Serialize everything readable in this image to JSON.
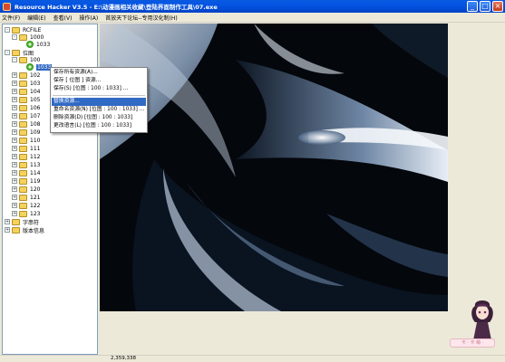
{
  "window": {
    "title": "Resource Hacker V3.5  -  E:\\动漫画相关收藏\\登陆界面制作工具\\07.exe",
    "minimize": "_",
    "maximize": "□",
    "close": "×"
  },
  "menu": [
    "文件(F)",
    "编辑(E)",
    "查看(V)",
    "操作(A)",
    "首放天下论坛--专用汉化制(H)"
  ],
  "tree": [
    {
      "label": "RCFILE",
      "icon": "folder-icon",
      "exp": "-"
    },
    {
      "label": "1000",
      "icon": "folder-icon",
      "exp": "-"
    },
    {
      "label": "1033",
      "icon": "gear-icon",
      "exp": ""
    },
    {
      "label": "位图",
      "icon": "folder-icon",
      "exp": "-"
    },
    {
      "label": "100",
      "icon": "folder-icon",
      "exp": "-"
    },
    {
      "label": "1033",
      "icon": "gear-icon",
      "exp": "",
      "selected": true
    },
    {
      "label": "102",
      "icon": "folder-icon",
      "exp": "+"
    },
    {
      "label": "103",
      "icon": "folder-icon",
      "exp": "+"
    },
    {
      "label": "104",
      "icon": "folder-icon",
      "exp": "+"
    },
    {
      "label": "105",
      "icon": "folder-icon",
      "exp": "+"
    },
    {
      "label": "106",
      "icon": "folder-icon",
      "exp": "+"
    },
    {
      "label": "107",
      "icon": "folder-icon",
      "exp": "+"
    },
    {
      "label": "108",
      "icon": "folder-icon",
      "exp": "+"
    },
    {
      "label": "109",
      "icon": "folder-icon",
      "exp": "+"
    },
    {
      "label": "110",
      "icon": "folder-icon",
      "exp": "+"
    },
    {
      "label": "111",
      "icon": "folder-icon",
      "exp": "+"
    },
    {
      "label": "112",
      "icon": "folder-icon",
      "exp": "+"
    },
    {
      "label": "113",
      "icon": "folder-icon",
      "exp": "+"
    },
    {
      "label": "114",
      "icon": "folder-icon",
      "exp": "+"
    },
    {
      "label": "119",
      "icon": "folder-icon",
      "exp": "+"
    },
    {
      "label": "120",
      "icon": "folder-icon",
      "exp": "+"
    },
    {
      "label": "121",
      "icon": "folder-icon",
      "exp": "+"
    },
    {
      "label": "122",
      "icon": "folder-icon",
      "exp": "+"
    },
    {
      "label": "123",
      "icon": "folder-icon",
      "exp": "+"
    },
    {
      "label": "字串符",
      "icon": "folder-icon",
      "exp": "+"
    },
    {
      "label": "版本信息",
      "icon": "folder-icon",
      "exp": "+"
    }
  ],
  "context_menu": {
    "items": [
      {
        "label": "保存所有资源(A)...",
        "highlight": false
      },
      {
        "label": "保存 [ 位图 ] 资源...",
        "highlight": false
      },
      {
        "label": "保存(S) [位图 : 100 : 1033] ...",
        "highlight": false
      },
      {
        "label": "替换资源...",
        "highlight": true
      },
      {
        "label": "重命名资源(N) [位图 : 100 : 1033] ...",
        "highlight": false
      },
      {
        "label": "删除资源(D) [位图 : 100 : 1033]",
        "highlight": false
      },
      {
        "label": "更改语言(L) [位图 : 100 : 1033]",
        "highlight": false
      }
    ]
  },
  "status": {
    "text": "2,359,338"
  },
  "mascot": {
    "label": "卡 · 卡 萌 ·"
  }
}
